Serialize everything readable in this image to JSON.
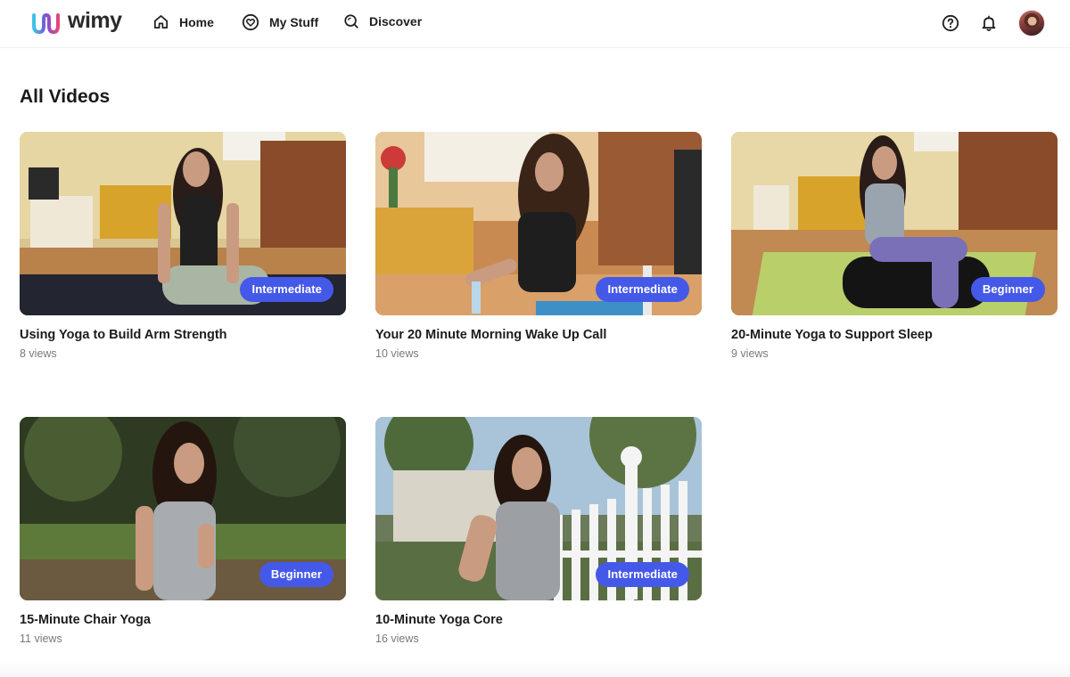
{
  "brand": {
    "name": "wimy"
  },
  "nav": {
    "items": [
      {
        "label": "Home",
        "icon": "home-icon"
      },
      {
        "label": "My Stuff",
        "icon": "heart-circle-icon"
      },
      {
        "label": "Discover",
        "icon": "search-icon"
      }
    ],
    "right_icons": [
      "help-icon",
      "bell-icon"
    ],
    "avatar": "user-avatar"
  },
  "page": {
    "title": "All Videos"
  },
  "videos": [
    {
      "title": "Using Yoga to Build Arm Strength",
      "views": "8 views",
      "level": "Intermediate"
    },
    {
      "title": "Your 20 Minute Morning Wake Up Call",
      "views": "10 views",
      "level": "Intermediate"
    },
    {
      "title": "20-Minute Yoga to Support Sleep",
      "views": "9 views",
      "level": "Beginner"
    },
    {
      "title": "15-Minute Chair Yoga",
      "views": "11 views",
      "level": "Beginner"
    },
    {
      "title": "10-Minute Yoga Core",
      "views": "16 views",
      "level": "Intermediate"
    }
  ],
  "colors": {
    "badge": "#4559e8",
    "logo_cyan": "#3fc4e8",
    "logo_pink": "#e8457a",
    "logo_purple": "#7a4fd6"
  }
}
